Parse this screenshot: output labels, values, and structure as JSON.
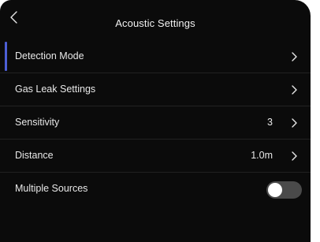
{
  "header": {
    "title": "Acoustic Settings",
    "back_icon": "chevron-left-icon"
  },
  "settings": {
    "detection_mode": {
      "label": "Detection Mode"
    },
    "gas_leak": {
      "label": "Gas Leak Settings"
    },
    "sensitivity": {
      "label": "Sensitivity",
      "value": "3"
    },
    "distance": {
      "label": "Distance",
      "value": "1.0m"
    },
    "multiple_sources": {
      "label": "Multiple Sources",
      "enabled": false
    }
  },
  "colors": {
    "background": "#0b0b0b",
    "accent": "#4d5fd6",
    "toggle_off": "#4a4a4a"
  }
}
